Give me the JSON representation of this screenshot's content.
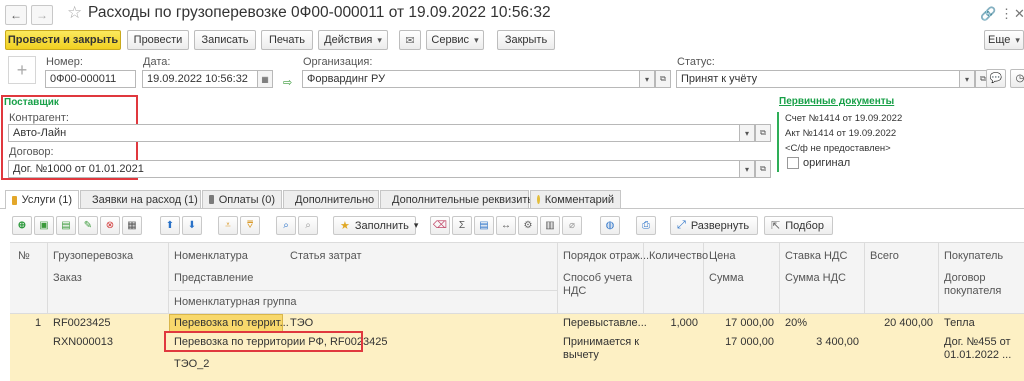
{
  "window": {
    "title": "Расходы по грузоперевозке  0Ф00-000011 от 19.09.2022 10:56:32"
  },
  "toolbar": {
    "post_close": "Провести и закрыть",
    "post": "Провести",
    "save": "Записать",
    "print": "Печать",
    "actions": "Действия",
    "service": "Сервис",
    "close": "Закрыть",
    "more": "Еще"
  },
  "header": {
    "number_label": "Номер:",
    "number_value": "0Ф00-000011",
    "date_label": "Дата:",
    "date_value": "19.09.2022 10:56:32",
    "org_label": "Организация:",
    "org_value": "Форвардинг РУ",
    "status_label": "Статус:",
    "status_value": "Принят к учёту"
  },
  "supplier": {
    "section_title": "Поставщик",
    "contractor_label": "Контрагент:",
    "contractor_value": "Авто-Лайн",
    "contract_label": "Договор:",
    "contract_value": "Дог. №1000 от 01.01.2021"
  },
  "primary_docs": {
    "title": "Первичные документы",
    "invoice": "Счет №1414 от 19.09.2022",
    "act": "Акт №1414 от 19.09.2022",
    "vat_invoice": "<С/ф не предоставлен>",
    "original_label": "оригинал"
  },
  "tabs": [
    {
      "label": "Услуги (1)"
    },
    {
      "label": "Заявки на расход (1)"
    },
    {
      "label": "Оплаты (0)"
    },
    {
      "label": "Дополнительно"
    },
    {
      "label": "Дополнительные реквизиты"
    },
    {
      "label": "Комментарий"
    }
  ],
  "table_toolbar": {
    "fill": "Заполнить",
    "expand": "Развернуть",
    "select": "Подбор"
  },
  "table": {
    "headers": {
      "num": "№",
      "cargo": "Грузоперевозка",
      "order": "Заказ",
      "nomenclature": "Номенклатура",
      "representation": "Представление",
      "nomenclature_group": "Номенклатурная группа",
      "cost_item": "Статья затрат",
      "reflection_order": "Порядок отраж...",
      "vat_method_1": "Способ учета",
      "vat_method_2": "НДС",
      "quantity": "Количество",
      "price": "Цена",
      "amount": "Сумма",
      "vat_rate": "Ставка НДС",
      "vat_amount": "Сумма НДС",
      "total": "Всего",
      "buyer": "Покупатель",
      "buyer_contract_1": "Договор",
      "buyer_contract_2": "покупателя"
    },
    "row": {
      "num": "1",
      "cargo": "RF0023425",
      "order": "RXN000013",
      "nomenclature": "Перевозка по террит...",
      "representation": "Перевозка по территории РФ, RF0023425",
      "nomenclature_group": "ТЭО_2",
      "cost_item": "ТЭО",
      "reflection_order": "Перевыставле...",
      "vat_method_1": "Принимается к",
      "vat_method_2": "вычету",
      "quantity": "1,000",
      "price": "17 000,00",
      "amount": "17 000,00",
      "vat_rate": "20%",
      "vat_amount": "3 400,00",
      "total": "20 400,00",
      "buyer": "Тепла",
      "buyer_contract_1": "Дог. №455 от",
      "buyer_contract_2": "01.01.2022 ..."
    }
  },
  "colors": {
    "primary_button": "#f1d021",
    "row_highlight": "#fdf0c4",
    "cell_highlight": "#f8d86c",
    "annotation_red": "#e0383e",
    "section_green": "#18a048"
  }
}
